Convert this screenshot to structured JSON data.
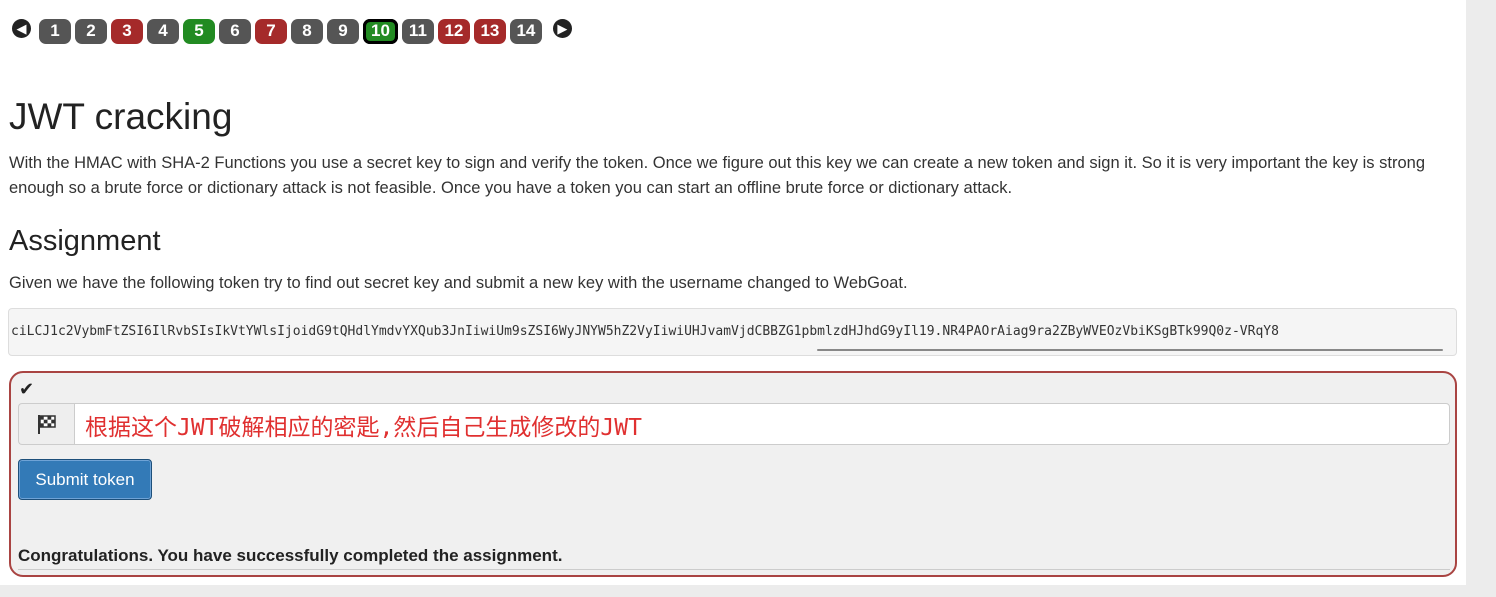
{
  "pagination": {
    "prev_icon": "arrow-left-icon",
    "next_icon": "arrow-right-icon",
    "pages": [
      {
        "label": "1",
        "status": "grey"
      },
      {
        "label": "2",
        "status": "grey"
      },
      {
        "label": "3",
        "status": "red"
      },
      {
        "label": "4",
        "status": "grey"
      },
      {
        "label": "5",
        "status": "green"
      },
      {
        "label": "6",
        "status": "grey"
      },
      {
        "label": "7",
        "status": "red"
      },
      {
        "label": "8",
        "status": "grey"
      },
      {
        "label": "9",
        "status": "grey"
      },
      {
        "label": "10",
        "status": "green",
        "current": true
      },
      {
        "label": "11",
        "status": "grey"
      },
      {
        "label": "12",
        "status": "red"
      },
      {
        "label": "13",
        "status": "red"
      },
      {
        "label": "14",
        "status": "grey"
      }
    ]
  },
  "lesson": {
    "title": "JWT cracking",
    "intro": "With the HMAC with SHA-2 Functions you use a secret key to sign and verify the token. Once we figure out this key we can create a new token and sign it. So it is very important the key is strong enough so a brute force or dictionary attack is not feasible. Once you have a token you can start an offline brute force or dictionary attack.",
    "assignment_heading": "Assignment",
    "assignment_text": "Given we have the following token try to find out secret key and submit a new key with the username changed to WebGoat.",
    "token": "ciLCJ1c2VybmFtZSI6IlRvbSIsIkVtYWlsIjoidG9tQHdlYmdvYXQub3JnIiwiUm9sZSI6WyJNYW5hZ2VyIiwiUHJvamVjdCBBZG1pbmlzdHJhdG9yIl19.NR4PAOrAiag9ra2ZByWVEOzVbiKSgBTk99Q0z-VRqY8"
  },
  "attack_form": {
    "check_icon": "checkmark-icon",
    "flag_icon": "checkered-flag-icon",
    "input_value": "",
    "annotation": "根据这个JWT破解相应的密匙,然后自己生成修改的JWT",
    "submit_label": "Submit token",
    "feedback": "Congratulations. You have successfully completed the assignment."
  },
  "colors": {
    "page_grey": "#555555",
    "page_red": "#a52a2a",
    "page_green": "#228b22",
    "form_border": "#a94442",
    "submit_bg": "#337ab7",
    "annotation_red": "#e03030"
  }
}
